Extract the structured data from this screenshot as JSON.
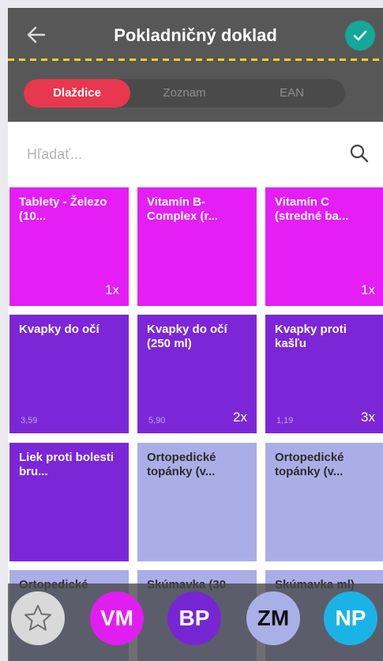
{
  "header": {
    "title": "Pokladničný doklad"
  },
  "tabs": [
    {
      "label": "Dlaždice",
      "active": true
    },
    {
      "label": "Zoznam",
      "active": false
    },
    {
      "label": "EAN",
      "active": false
    }
  ],
  "search": {
    "placeholder": "Hľadať..."
  },
  "tiles": [
    {
      "name": "Tablety - Železo (10...",
      "price": "",
      "qty": "1x",
      "color": "#e41ef5"
    },
    {
      "name": "Vitamín B-Complex (r...",
      "price": "",
      "qty": "",
      "color": "#e41ef5"
    },
    {
      "name": "Vitamín C (stredné ba...",
      "price": "",
      "qty": "1x",
      "color": "#e41ef5"
    },
    {
      "name": "Kvapky do očí",
      "price": "3,59",
      "qty": "",
      "color": "#7b27d8"
    },
    {
      "name": "Kvapky do očí (250 ml)",
      "price": "5,90",
      "qty": "2x",
      "color": "#7b27d8"
    },
    {
      "name": "Kvapky proti kašľu",
      "price": "1,19",
      "qty": "3x",
      "color": "#7b27d8"
    },
    {
      "name": "Liek proti bolesti bru...",
      "price": "",
      "qty": "",
      "color": "#7b27d8"
    },
    {
      "name": "Ortopedické topánky (v...",
      "price": "",
      "qty": "",
      "color": "#aaaee6"
    },
    {
      "name": "Ortopedické topánky (v...",
      "price": "",
      "qty": "",
      "color": "#aaaee6"
    },
    {
      "name": "Ortopedické",
      "price": "",
      "qty": "",
      "color": "#aaaee6"
    },
    {
      "name": "Skúmavka (30",
      "price": "",
      "qty": "",
      "color": "#aaaee6"
    },
    {
      "name": "Skúmavka ml)",
      "price": "",
      "qty": "",
      "color": "#aaaee6"
    }
  ],
  "bottom": {
    "favorite_icon": "star-icon",
    "buttons": [
      {
        "label": "VM",
        "color": "#e11ef2"
      },
      {
        "label": "BP",
        "color": "#7726d3"
      },
      {
        "label": "ZM",
        "color": "#a9b0e8"
      },
      {
        "label": "NP",
        "color": "#1bb3e6"
      }
    ]
  }
}
